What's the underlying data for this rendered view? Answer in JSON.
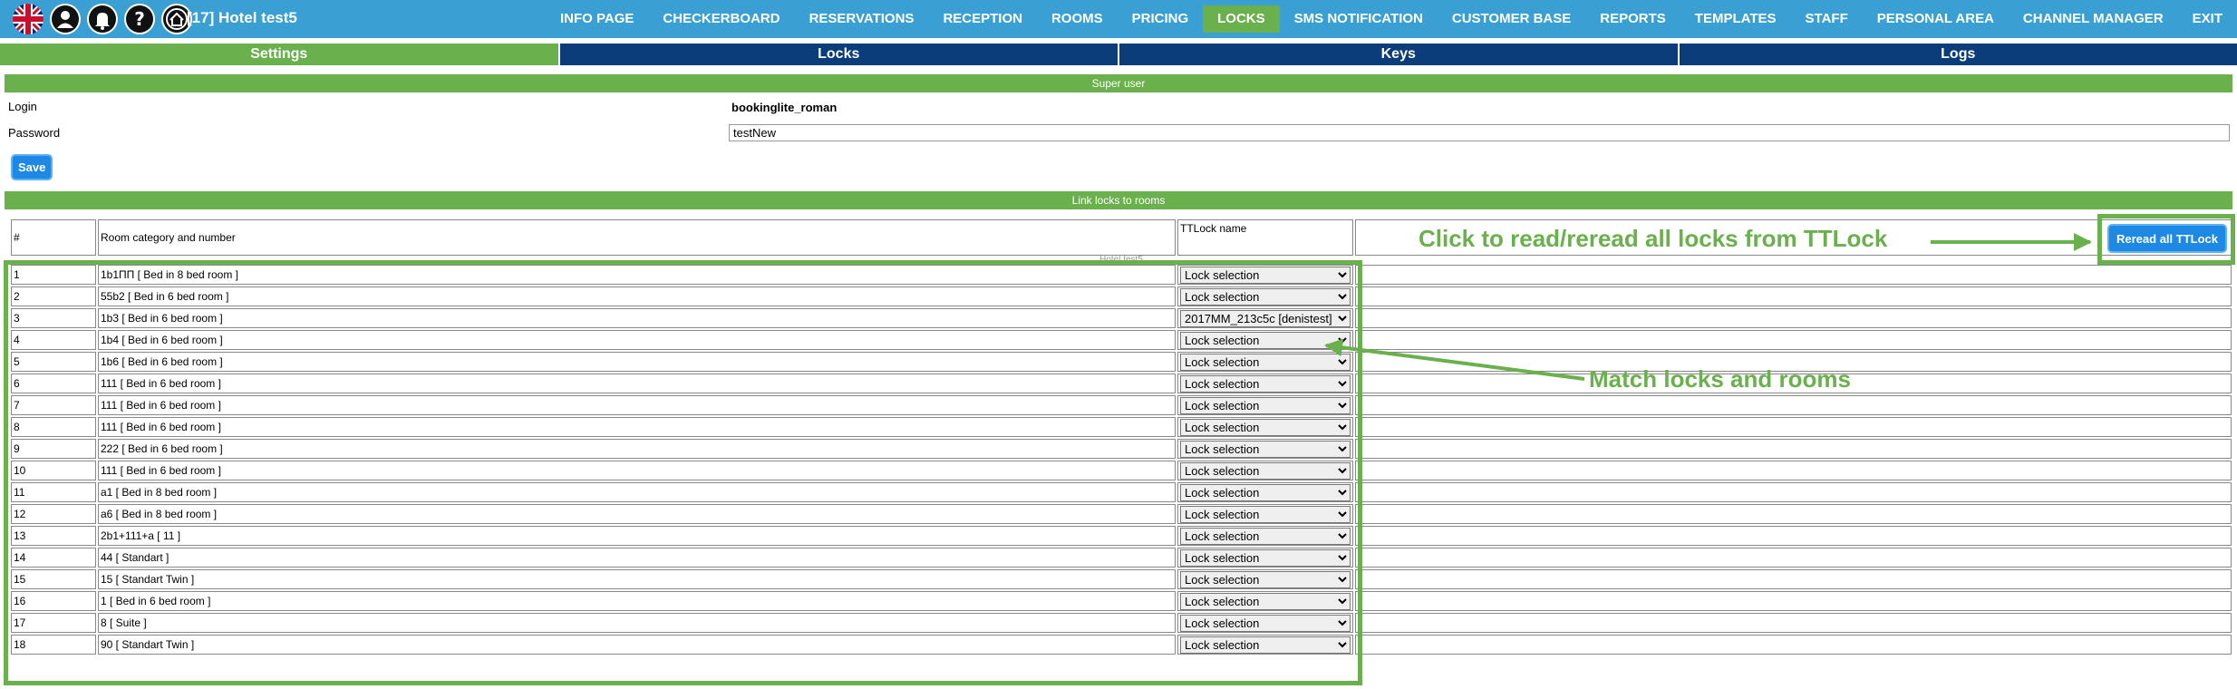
{
  "header": {
    "hotel_title": "[17] Hotel test5",
    "icons": [
      "uk-flag-icon",
      "user-icon",
      "bell-icon",
      "help-icon",
      "home-icon"
    ],
    "nav": [
      {
        "label": "INFO PAGE",
        "active": false
      },
      {
        "label": "CHECKERBOARD",
        "active": false
      },
      {
        "label": "RESERVATIONS",
        "active": false
      },
      {
        "label": "RECEPTION",
        "active": false
      },
      {
        "label": "ROOMS",
        "active": false
      },
      {
        "label": "PRICING",
        "active": false
      },
      {
        "label": "LOCKS",
        "active": true
      },
      {
        "label": "SMS NOTIFICATION",
        "active": false
      },
      {
        "label": "CUSTOMER BASE",
        "active": false
      },
      {
        "label": "REPORTS",
        "active": false
      },
      {
        "label": "TEMPLATES",
        "active": false
      },
      {
        "label": "STAFF",
        "active": false
      },
      {
        "label": "PERSONAL AREA",
        "active": false
      },
      {
        "label": "CHANNEL MANAGER",
        "active": false
      },
      {
        "label": "EXIT",
        "active": false
      }
    ]
  },
  "subtabs": [
    {
      "label": "Settings",
      "active": true
    },
    {
      "label": "Locks",
      "active": false
    },
    {
      "label": "Keys",
      "active": false
    },
    {
      "label": "Logs",
      "active": false
    }
  ],
  "superuser": {
    "section_title": "Super user",
    "login_label": "Login",
    "login_value": "bookinglite_roman",
    "password_label": "Password",
    "password_value": "testNew",
    "save_label": "Save"
  },
  "link_section": {
    "title": "Link locks to rooms",
    "col_number": "#",
    "col_room": "Room category and number",
    "col_ttlock": "TTLock name",
    "group_label": "Hotel test5",
    "reread_label": "Reread all TTLock",
    "default_option": "Lock selection",
    "rows": [
      {
        "num": "1",
        "room": "1b1ПП [ Bed in 8 bed room ]",
        "lock": "Lock selection"
      },
      {
        "num": "2",
        "room": "55b2 [ Bed in 6 bed room ]",
        "lock": "Lock selection"
      },
      {
        "num": "3",
        "room": "1b3 [ Bed in 6 bed room ]",
        "lock": "2017MM_213c5c [denistest]"
      },
      {
        "num": "4",
        "room": "1b4 [ Bed in 6 bed room ]",
        "lock": "Lock selection"
      },
      {
        "num": "5",
        "room": "1b6 [ Bed in 6 bed room ]",
        "lock": "Lock selection"
      },
      {
        "num": "6",
        "room": "111 [ Bed in 6 bed room ]",
        "lock": "Lock selection"
      },
      {
        "num": "7",
        "room": "111 [ Bed in 6 bed room ]",
        "lock": "Lock selection"
      },
      {
        "num": "8",
        "room": "111 [ Bed in 6 bed room ]",
        "lock": "Lock selection"
      },
      {
        "num": "9",
        "room": "222 [ Bed in 6 bed room ]",
        "lock": "Lock selection"
      },
      {
        "num": "10",
        "room": "111 [ Bed in 6 bed room ]",
        "lock": "Lock selection"
      },
      {
        "num": "11",
        "room": "a1 [ Bed in 8 bed room ]",
        "lock": "Lock selection"
      },
      {
        "num": "12",
        "room": "a6 [ Bed in 8 bed room ]",
        "lock": "Lock selection"
      },
      {
        "num": "13",
        "room": "2b1+111+a [ 11 ]",
        "lock": "Lock selection"
      },
      {
        "num": "14",
        "room": "44 [ Standart ]",
        "lock": "Lock selection"
      },
      {
        "num": "15",
        "room": "15 [ Standart Twin ]",
        "lock": "Lock selection"
      },
      {
        "num": "16",
        "room": "1 [ Bed in 6 bed room ]",
        "lock": "Lock selection"
      },
      {
        "num": "17",
        "room": "8 [ Suite ]",
        "lock": "Lock selection"
      },
      {
        "num": "18",
        "room": "90 [ Standart Twin ]",
        "lock": "Lock selection"
      }
    ]
  },
  "annotations": {
    "reread": "Click to read/reread all locks from TTLock",
    "match": "Match locks and rooms"
  },
  "colors": {
    "topbar": "#3aa0d4",
    "accent_green": "#6ab04c",
    "dark_blue": "#0b3d7a",
    "button_blue": "#1e88e5"
  }
}
